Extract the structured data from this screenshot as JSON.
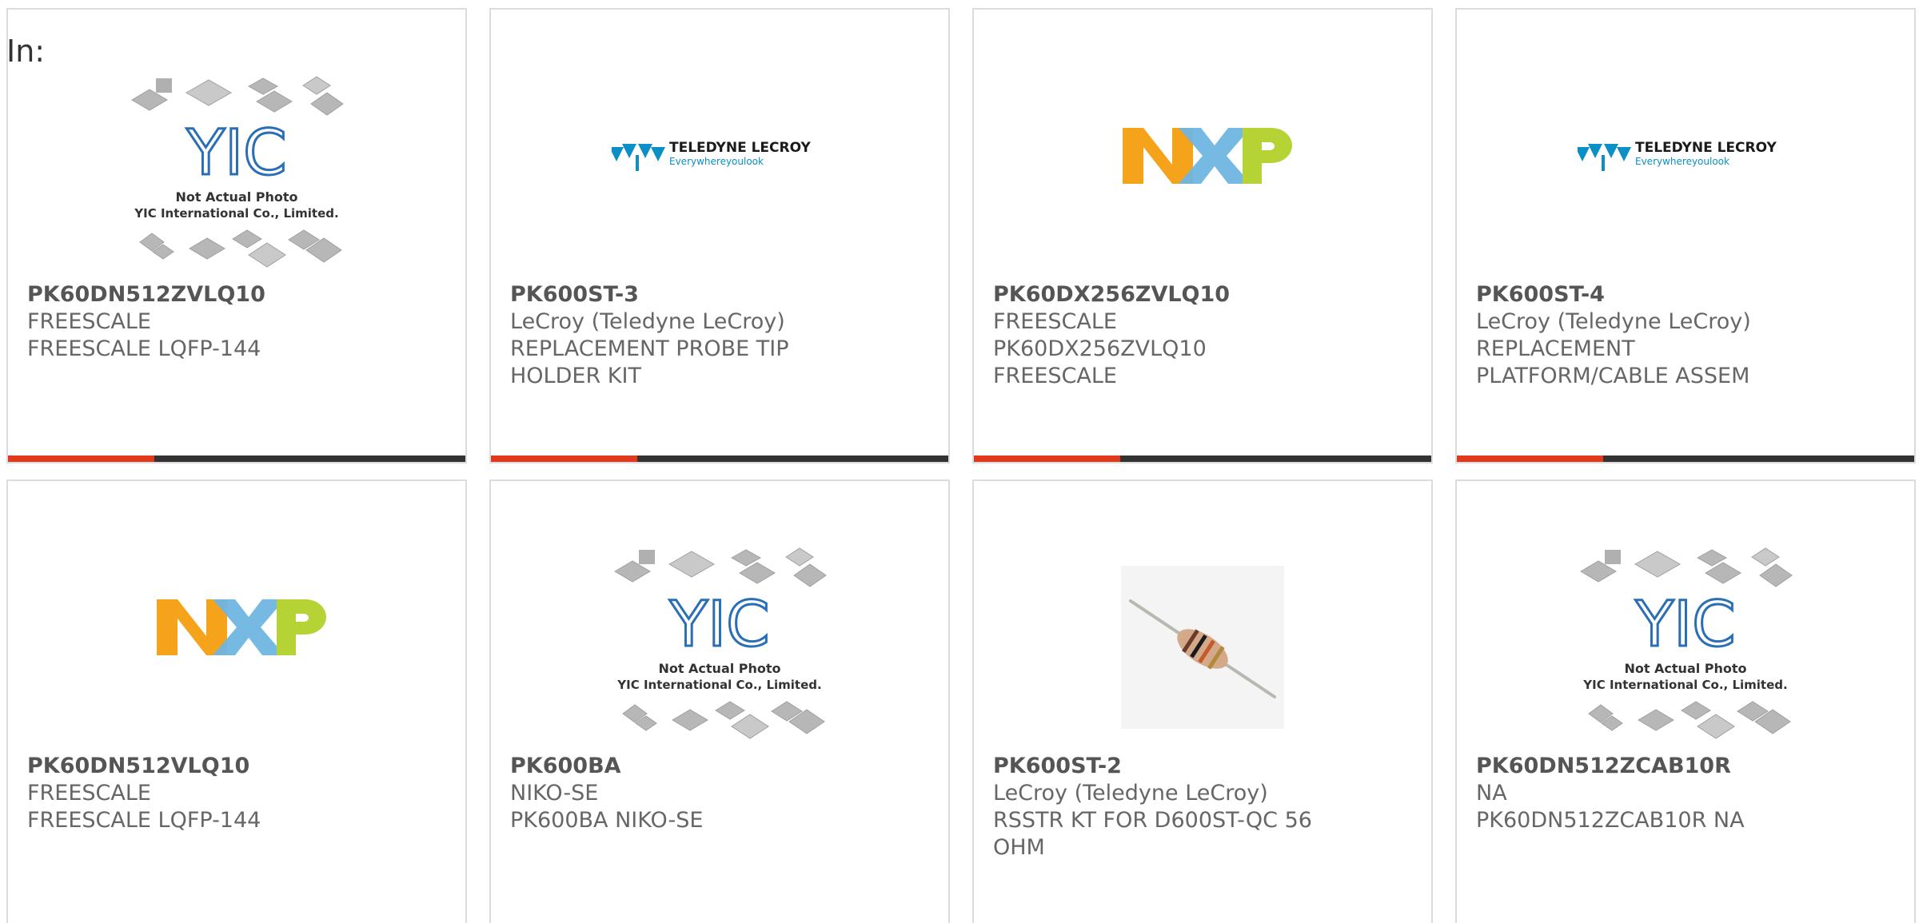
{
  "header": {
    "label": "In:"
  },
  "products": [
    {
      "part_number": "PK60DN512ZVLQ10",
      "manufacturer": "FREESCALE",
      "description": "FREESCALE LQFP-144",
      "image": "yic-placeholder",
      "image_caption": [
        "Not Actual Photo",
        "YIC International Co., Limited."
      ],
      "logo_text": "YIC"
    },
    {
      "part_number": "PK600ST-3",
      "manufacturer": "LeCroy (Teledyne LeCroy)",
      "description": "REPLACEMENT PROBE TIP HOLDER KIT",
      "image": "teledyne-lecroy-logo",
      "logo_text": [
        "TELEDYNE LECROY",
        "Everywhereyoulook"
      ]
    },
    {
      "part_number": "PK60DX256ZVLQ10",
      "manufacturer": "FREESCALE",
      "description": "PK60DX256ZVLQ10 FREESCALE",
      "image": "nxp-logo",
      "logo_text": "NXP"
    },
    {
      "part_number": "PK600ST-4",
      "manufacturer": "LeCroy (Teledyne LeCroy)",
      "description": "REPLACEMENT PLATFORM/CABLE ASSEM",
      "image": "teledyne-lecroy-logo",
      "logo_text": [
        "TELEDYNE LECROY",
        "Everywhereyoulook"
      ]
    },
    {
      "part_number": "PK60DN512VLQ10",
      "manufacturer": "FREESCALE",
      "description": "FREESCALE LQFP-144",
      "image": "nxp-logo",
      "logo_text": "NXP"
    },
    {
      "part_number": "PK600BA",
      "manufacturer": "NIKO-SE",
      "description": "PK600BA NIKO-SE",
      "image": "yic-placeholder",
      "image_caption": [
        "Not Actual Photo",
        "YIC International Co., Limited."
      ],
      "logo_text": "YIC"
    },
    {
      "part_number": "PK600ST-2",
      "manufacturer": "LeCroy (Teledyne LeCroy)",
      "description": "RSSTR KT FOR D600ST-QC 56 OHM",
      "image": "resistor-photo"
    },
    {
      "part_number": "PK60DN512ZCAB10R",
      "manufacturer": "NA",
      "description": "PK60DN512ZCAB10R NA",
      "image": "yic-placeholder",
      "image_caption": [
        "Not Actual Photo",
        "YIC International Co., Limited."
      ],
      "logo_text": "YIC"
    }
  ],
  "colors": {
    "accent_bar": "#e03a1e",
    "bar": "#333333",
    "nxp_orange": "#f5a31a",
    "nxp_blue": "#6fb5e2",
    "nxp_green": "#b5d334",
    "teledyne_blue": "#0a8fc7",
    "yic_blue": "#2a6fb5"
  }
}
